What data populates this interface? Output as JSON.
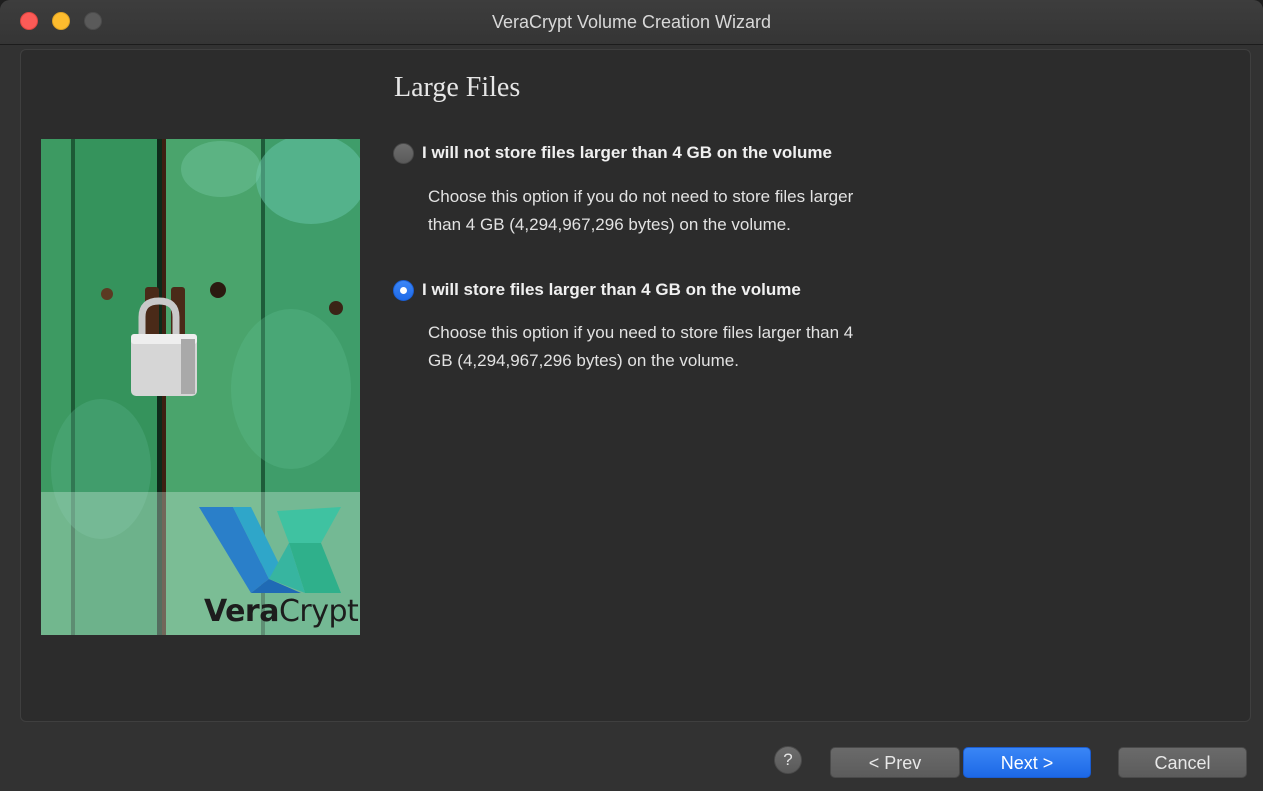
{
  "window": {
    "title": "VeraCrypt Volume Creation Wizard"
  },
  "page": {
    "heading": "Large Files"
  },
  "options": [
    {
      "label": "I will not store files larger than 4 GB on the volume",
      "description_line1": "Choose this option if you do not need to store files larger",
      "description_line2": "than 4 GB (4,294,967,296 bytes) on the volume.",
      "selected": false
    },
    {
      "label": "I will store files larger than 4 GB on the volume",
      "description_line1": "Choose this option if you need to store files larger than 4",
      "description_line2": "GB (4,294,967,296 bytes) on the volume.",
      "selected": true
    }
  ],
  "logo": {
    "brand_bold": "Vera",
    "brand_light": "Crypt"
  },
  "buttons": {
    "help": "?",
    "prev": "< Prev",
    "next": "Next >",
    "cancel": "Cancel"
  },
  "colors": {
    "accent": "#2a78f0",
    "close": "#fc5b57",
    "minimize": "#fdbc2e"
  }
}
